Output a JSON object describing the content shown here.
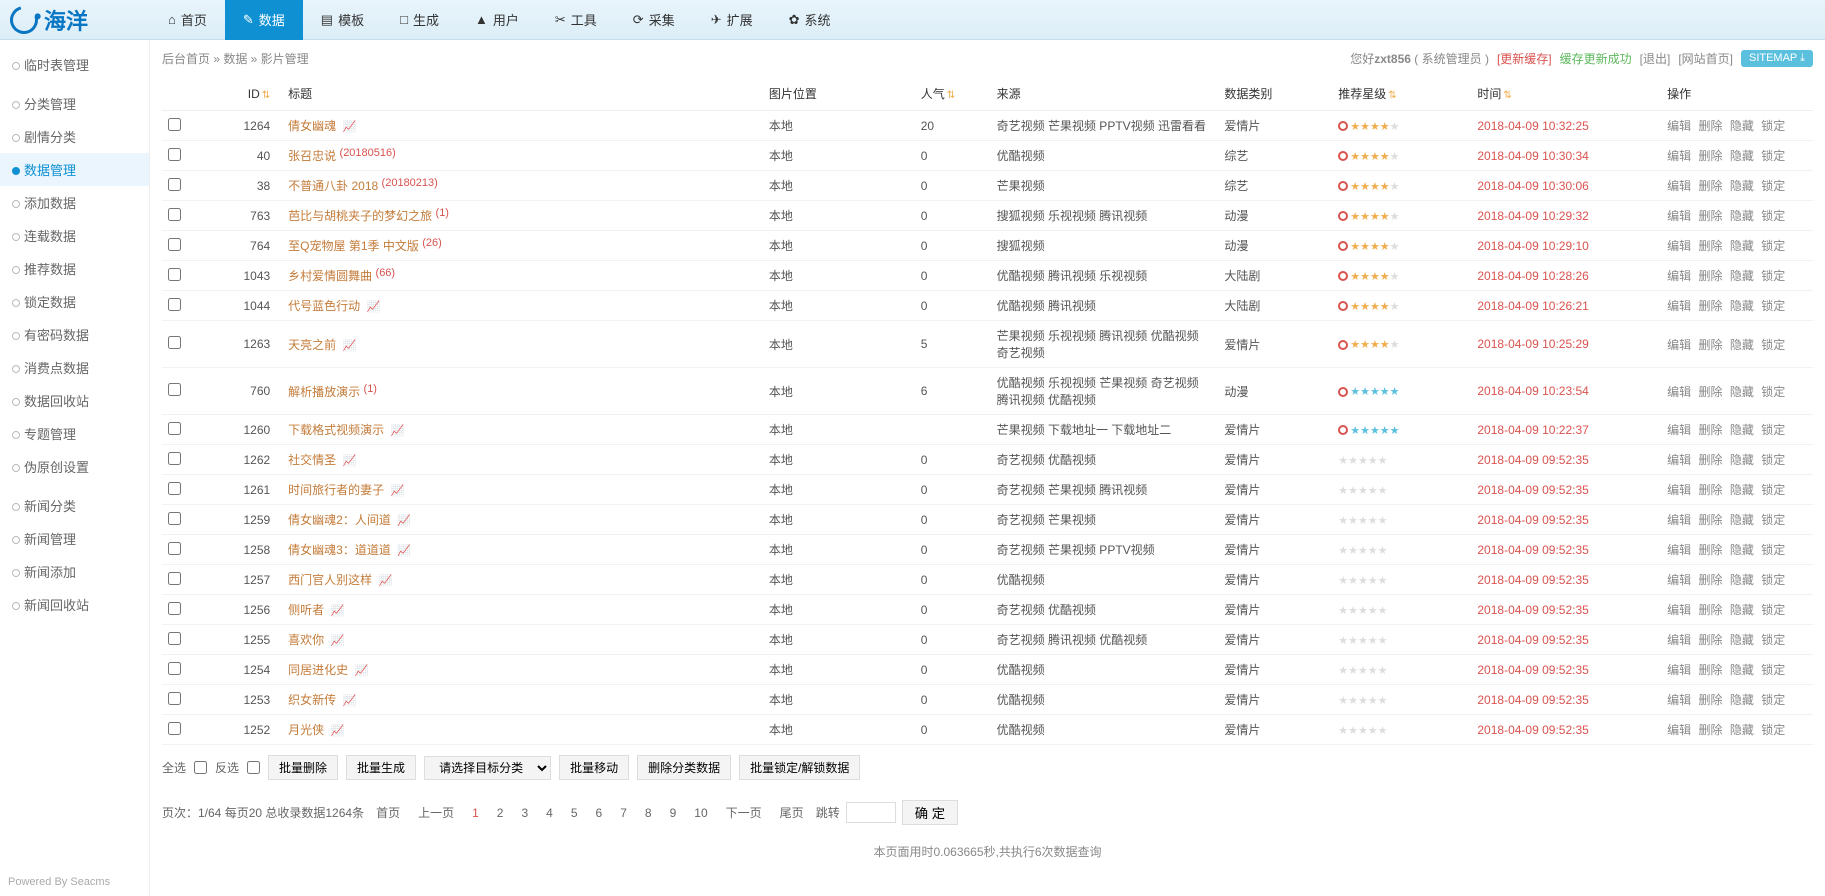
{
  "logo": "海洋",
  "topnav": [
    {
      "icon": "⌂",
      "label": "首页"
    },
    {
      "icon": "✎",
      "label": "数据",
      "active": true
    },
    {
      "icon": "▤",
      "label": "模板"
    },
    {
      "icon": "□",
      "label": "生成"
    },
    {
      "icon": "▲",
      "label": "用户"
    },
    {
      "icon": "✂",
      "label": "工具"
    },
    {
      "icon": "⟳",
      "label": "采集"
    },
    {
      "icon": "✈",
      "label": "扩展"
    },
    {
      "icon": "✿",
      "label": "系统"
    }
  ],
  "breadcrumb": "后台首页 » 数据 » 影片管理",
  "crumb_right": {
    "greet_prefix": "您好",
    "user": "zxt856",
    "role": "( 系统管理员 )",
    "links": [
      {
        "label": "[更新缓存]",
        "cls": "red"
      },
      {
        "label": "缓存更新成功",
        "cls": "green"
      },
      {
        "label": "[退出]"
      },
      {
        "label": "[网站首页]"
      }
    ],
    "sitemap": "SITEMAP ⤓"
  },
  "sidebar": [
    {
      "label": "临时表管理"
    },
    {
      "sep": true
    },
    {
      "label": "分类管理"
    },
    {
      "label": "剧情分类"
    },
    {
      "label": "数据管理",
      "active": true
    },
    {
      "label": "添加数据"
    },
    {
      "label": "连载数据"
    },
    {
      "label": "推荐数据"
    },
    {
      "label": "锁定数据"
    },
    {
      "label": "有密码数据"
    },
    {
      "label": "消费点数据"
    },
    {
      "label": "数据回收站"
    },
    {
      "label": "专题管理"
    },
    {
      "label": "伪原创设置"
    },
    {
      "sep": true
    },
    {
      "label": "新闻分类"
    },
    {
      "label": "新闻管理"
    },
    {
      "label": "新闻添加"
    },
    {
      "label": "新闻回收站"
    }
  ],
  "columns": {
    "id": "ID",
    "title": "标题",
    "loc": "图片位置",
    "pop": "人气",
    "source": "来源",
    "cat": "数据类别",
    "star": "推荐星级",
    "time": "时间",
    "op": "操作"
  },
  "op_labels": [
    "编辑",
    "删除",
    "隐藏",
    "锁定"
  ],
  "rows": [
    {
      "id": "1264",
      "title": "倩女幽魂",
      "fire": true,
      "loc": "本地",
      "pop": "20",
      "source": "奇艺视频 芒果视频 PPTV视频 迅雷看看",
      "cat": "爱情片",
      "star": "red4",
      "time": "2018-04-09 10:32:25"
    },
    {
      "id": "40",
      "title": "张召忠说",
      "sup": "(20180516)",
      "loc": "本地",
      "pop": "0",
      "source": "优酷视频",
      "cat": "综艺",
      "star": "red4",
      "time": "2018-04-09 10:30:34"
    },
    {
      "id": "38",
      "title": "不普通八卦 2018",
      "sup": "(20180213)",
      "loc": "本地",
      "pop": "0",
      "source": "芒果视频",
      "cat": "综艺",
      "star": "red4",
      "time": "2018-04-09 10:30:06"
    },
    {
      "id": "763",
      "title": "芭比与胡桃夹子的梦幻之旅",
      "sup": "(1)",
      "loc": "本地",
      "pop": "0",
      "source": "搜狐视频 乐视视频 腾讯视频",
      "cat": "动漫",
      "star": "red4",
      "time": "2018-04-09 10:29:32"
    },
    {
      "id": "764",
      "title": "至Q宠物屋 第1季 中文版",
      "sup": "(26)",
      "loc": "本地",
      "pop": "0",
      "source": "搜狐视频",
      "cat": "动漫",
      "star": "red4",
      "time": "2018-04-09 10:29:10"
    },
    {
      "id": "1043",
      "title": "乡村爱情圆舞曲",
      "sup": "(66)",
      "loc": "本地",
      "pop": "0",
      "source": "优酷视频 腾讯视频 乐视视频",
      "cat": "大陆剧",
      "star": "red4",
      "time": "2018-04-09 10:28:26"
    },
    {
      "id": "1044",
      "title": "代号蓝色行动",
      "fire": true,
      "loc": "本地",
      "pop": "0",
      "source": "优酷视频 腾讯视频",
      "cat": "大陆剧",
      "star": "red4",
      "time": "2018-04-09 10:26:21"
    },
    {
      "id": "1263",
      "title": "天亮之前",
      "fire": true,
      "loc": "本地",
      "pop": "5",
      "source": "芒果视频 乐视视频 腾讯视频 优酷视频 奇艺视频",
      "cat": "爱情片",
      "star": "red4",
      "time": "2018-04-09 10:25:29"
    },
    {
      "id": "760",
      "title": "解析播放演示",
      "sup": "(1)",
      "loc": "本地",
      "pop": "6",
      "source": "优酷视频 乐视视频 芒果视频 奇艺视频 腾讯视频 优酷视频",
      "cat": "动漫",
      "star": "blue5",
      "time": "2018-04-09 10:23:54"
    },
    {
      "id": "1260",
      "title": "下载格式视频演示",
      "fire": true,
      "loc": "本地",
      "pop": "",
      "source": "芒果视频 下载地址一 下载地址二",
      "cat": "爱情片",
      "star": "blue5",
      "time": "2018-04-09 10:22:37"
    },
    {
      "id": "1262",
      "title": "社交情圣",
      "fire": true,
      "loc": "本地",
      "pop": "0",
      "source": "奇艺视频 优酷视频",
      "cat": "爱情片",
      "star": "grey",
      "time": "2018-04-09 09:52:35"
    },
    {
      "id": "1261",
      "title": "时间旅行者的妻子",
      "fire": true,
      "loc": "本地",
      "pop": "0",
      "source": "奇艺视频 芒果视频 腾讯视频",
      "cat": "爱情片",
      "star": "grey",
      "time": "2018-04-09 09:52:35"
    },
    {
      "id": "1259",
      "title": "倩女幽魂2：人间道",
      "fire": true,
      "loc": "本地",
      "pop": "0",
      "source": "奇艺视频 芒果视频",
      "cat": "爱情片",
      "star": "grey",
      "time": "2018-04-09 09:52:35"
    },
    {
      "id": "1258",
      "title": "倩女幽魂3：道道道",
      "fire": true,
      "loc": "本地",
      "pop": "0",
      "source": "奇艺视频 芒果视频 PPTV视频",
      "cat": "爱情片",
      "star": "grey",
      "time": "2018-04-09 09:52:35"
    },
    {
      "id": "1257",
      "title": "西门官人别这样",
      "fire": true,
      "loc": "本地",
      "pop": "0",
      "source": "优酷视频",
      "cat": "爱情片",
      "star": "grey",
      "time": "2018-04-09 09:52:35"
    },
    {
      "id": "1256",
      "title": "侧听者",
      "fire": true,
      "loc": "本地",
      "pop": "0",
      "source": "奇艺视频 优酷视频",
      "cat": "爱情片",
      "star": "grey",
      "time": "2018-04-09 09:52:35"
    },
    {
      "id": "1255",
      "title": "喜欢你",
      "fire": true,
      "loc": "本地",
      "pop": "0",
      "source": "奇艺视频 腾讯视频 优酷视频",
      "cat": "爱情片",
      "star": "grey",
      "time": "2018-04-09 09:52:35"
    },
    {
      "id": "1254",
      "title": "同居进化史",
      "fire": true,
      "loc": "本地",
      "pop": "0",
      "source": "优酷视频",
      "cat": "爱情片",
      "star": "grey",
      "time": "2018-04-09 09:52:35"
    },
    {
      "id": "1253",
      "title": "织女新传",
      "fire": true,
      "loc": "本地",
      "pop": "0",
      "source": "优酷视频",
      "cat": "爱情片",
      "star": "grey",
      "time": "2018-04-09 09:52:35"
    },
    {
      "id": "1252",
      "title": "月光侠",
      "fire": true,
      "loc": "本地",
      "pop": "0",
      "source": "优酷视频",
      "cat": "爱情片",
      "star": "grey",
      "time": "2018-04-09 09:52:35"
    }
  ],
  "batch": {
    "selall": "全选",
    "invert": "反选",
    "btns": [
      "批量删除",
      "批量生成"
    ],
    "select_ph": "请选择目标分类",
    "btns2": [
      "批量移动",
      "删除分类数据",
      "批量锁定/解锁数据"
    ]
  },
  "pager": {
    "summary": "页次：1/64 每页20 总收录数据1264条",
    "first": "首页",
    "prev": "上一页",
    "pages": [
      "1",
      "2",
      "3",
      "4",
      "5",
      "6",
      "7",
      "8",
      "9",
      "10"
    ],
    "next": "下一页",
    "last": "尾页",
    "jump": "跳转",
    "go": "确 定"
  },
  "footer": "本页面用时0.063665秒,共执行6次数据查询",
  "powered": "Powered By Seacms"
}
